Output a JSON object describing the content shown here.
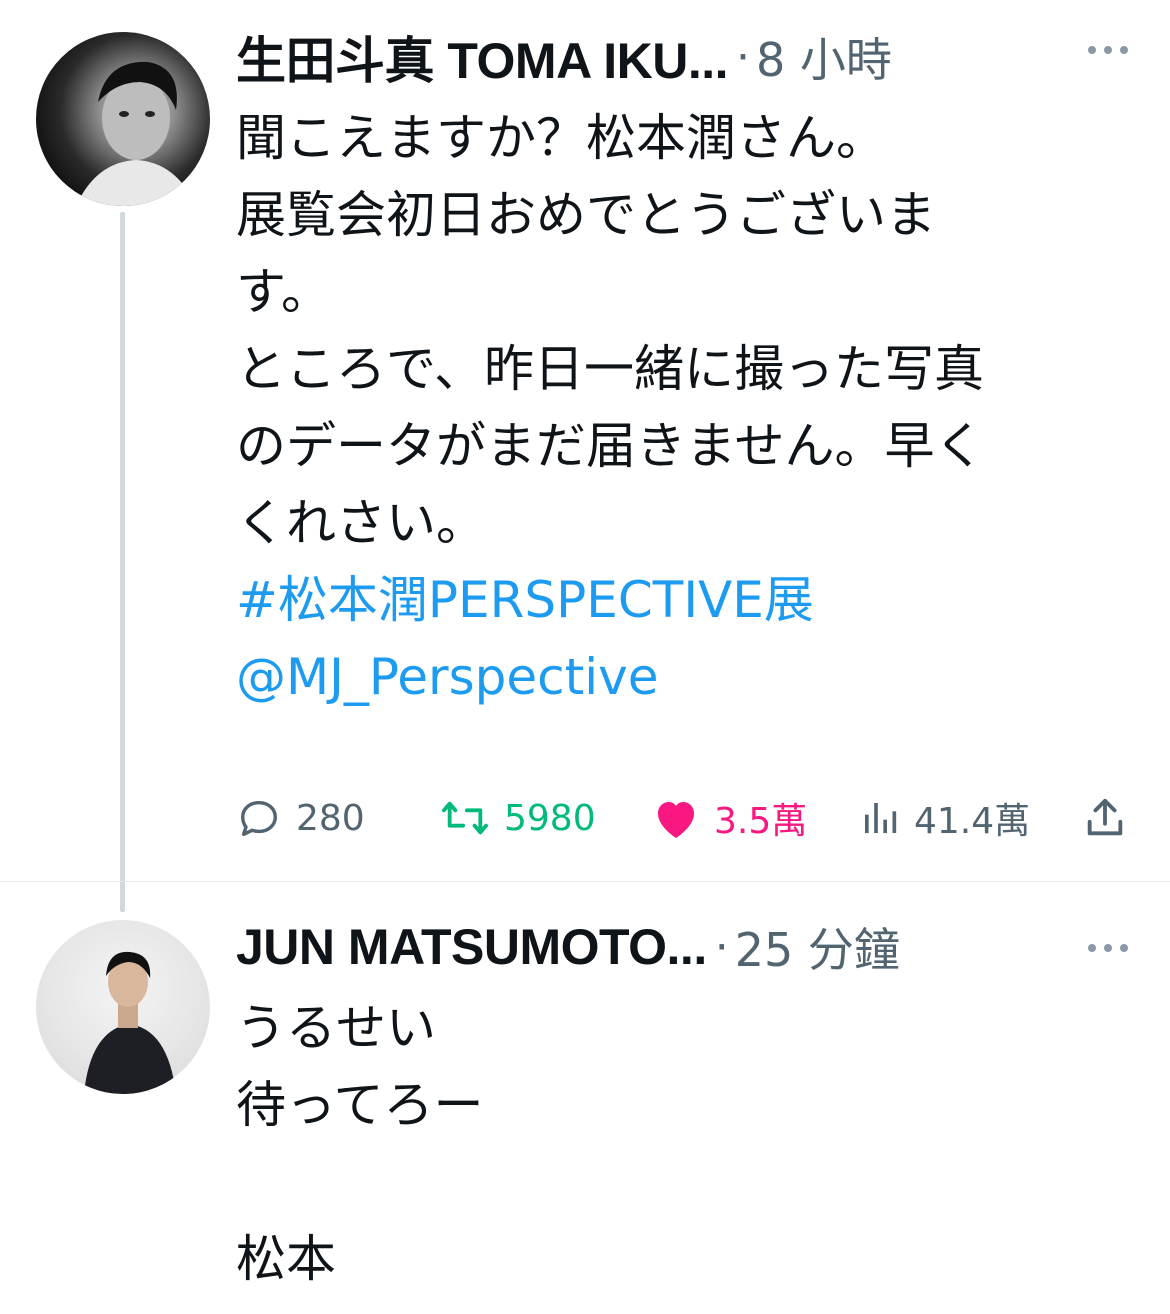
{
  "tweets": [
    {
      "display_name": "生田斗真 TOMA IKU...",
      "separator": "·",
      "time": "8 小時",
      "body_lines": [
        "聞こえますか？松本潤さん。",
        "展覧会初日おめでとうございま",
        "す。",
        "ところで、昨日一緒に撮った写真",
        "のデータがまだ届きません。早く",
        "くれさい。"
      ],
      "hashtag": "#松本潤PERSPECTIVE展",
      "mention": "@MJ_Perspective",
      "metrics": {
        "replies": "280",
        "retweets": "5980",
        "likes": "3.5萬",
        "views": "41.4萬"
      },
      "liked": true
    },
    {
      "display_name": "JUN MATSUMOTO...",
      "separator": "·",
      "time": "25 分鐘",
      "body_lines": [
        "うるせい",
        "待ってろー",
        "",
        "松本"
      ]
    }
  ],
  "icons": {
    "more": "more-dots-icon",
    "reply": "reply-bubble-icon",
    "retweet": "retweet-icon",
    "like": "heart-icon",
    "views": "bar-chart-icon",
    "share": "share-icon"
  },
  "colors": {
    "text": "#0f1419",
    "secondary": "#536471",
    "link": "#1d9bf0",
    "retweet": "#00ba7c",
    "like": "#f91880",
    "thread_line": "#cfd9de"
  }
}
